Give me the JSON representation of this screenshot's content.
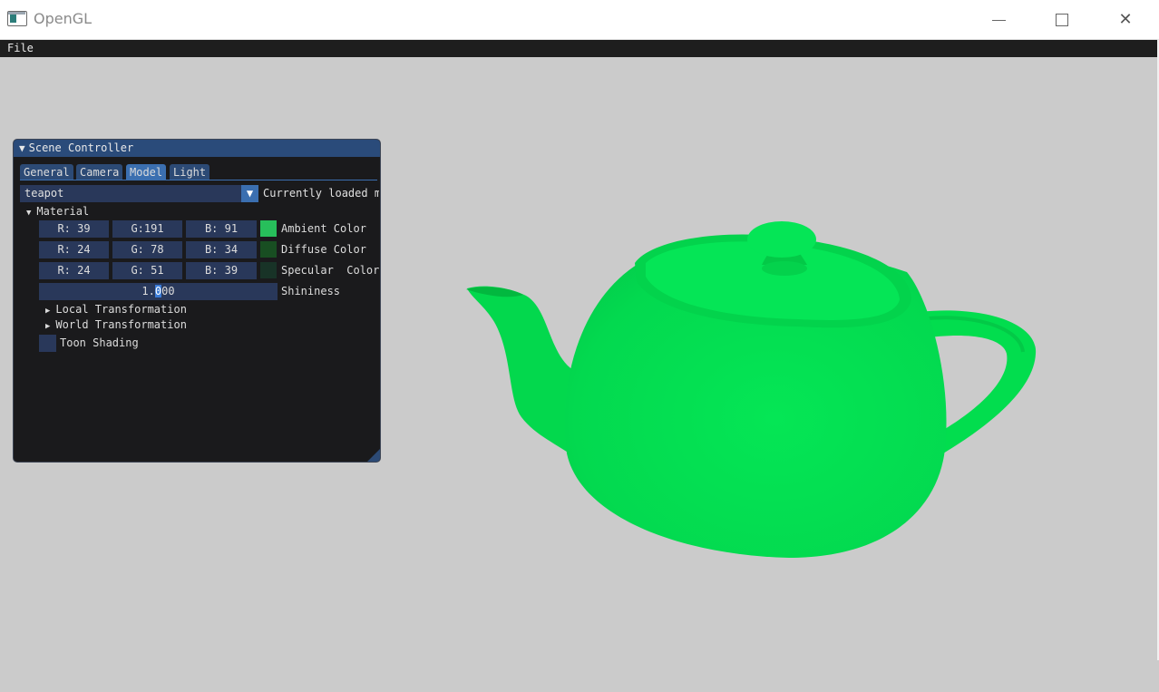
{
  "window": {
    "title": "OpenGL",
    "controls": {
      "minimize": "minimize-icon",
      "maximize": "maximize-icon",
      "close": "close-icon"
    }
  },
  "menubar": {
    "file": "File"
  },
  "panel": {
    "title": "Scene Controller",
    "tabs": [
      {
        "label": "General",
        "active": false
      },
      {
        "label": "Camera",
        "active": false
      },
      {
        "label": "Model",
        "active": true
      },
      {
        "label": "Light",
        "active": false
      }
    ],
    "model_combo": {
      "value": "teapot",
      "label": "Currently loaded m"
    },
    "material": {
      "header": "Material",
      "ambient": {
        "r": "R: 39",
        "g": "G:191",
        "b": "B: 91",
        "label": "Ambient Color",
        "color": "#27bf5b"
      },
      "diffuse": {
        "r": "R: 24",
        "g": "G: 78",
        "b": "B: 34",
        "label": "Diffuse Color",
        "color": "#184e22"
      },
      "specular": {
        "r": "R: 24",
        "g": "G: 51",
        "b": "B: 39",
        "label": "Specular  Color",
        "color": "#183327"
      },
      "shininess": {
        "pre": "1.",
        "cursor": "0",
        "post": "00",
        "label": "Shininess"
      }
    },
    "local_transformation": "Local Transformation",
    "world_transformation": "World Transformation",
    "toon_shading": {
      "label": "Toon Shading",
      "checked": false
    }
  },
  "viewport": {
    "background": "#cbcbcb",
    "model_color": "#00e04e"
  }
}
